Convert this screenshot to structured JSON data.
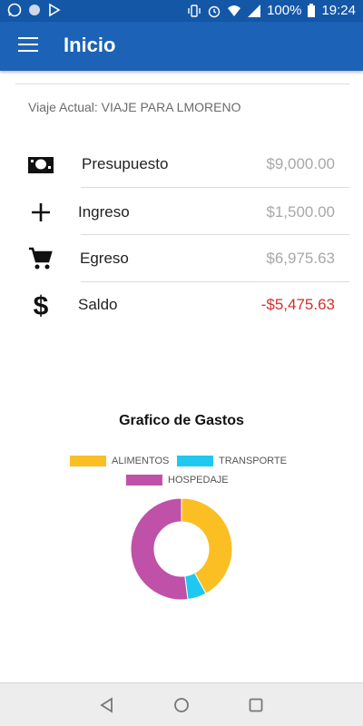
{
  "status": {
    "battery": "100%",
    "time": "19:24"
  },
  "appbar": {
    "title": "Inicio"
  },
  "trip": {
    "text": "Viaje Actual: VIAJE PARA LMORENO"
  },
  "rows": [
    {
      "label": "Presupuesto",
      "value": "$9,000.00",
      "icon": "money-icon"
    },
    {
      "label": "Ingreso",
      "value": "$1,500.00",
      "icon": "plus-icon"
    },
    {
      "label": "Egreso",
      "value": "$6,975.63",
      "icon": "cart-icon"
    },
    {
      "label": "Saldo",
      "value": "-$5,475.63",
      "icon": "dollar-icon"
    }
  ],
  "colors": {
    "primary": "#1c63b7",
    "negative": "#d32f2f",
    "alimentos": "#fbbf24",
    "transporte": "#1ec8f0",
    "hospedaje": "#c051a8"
  },
  "chart": {
    "title": "Grafico de Gastos",
    "legend": [
      "ALIMENTOS",
      "TRANSPORTE",
      "HOSPEDAJE"
    ]
  },
  "chart_data": {
    "type": "pie",
    "title": "Grafico de Gastos",
    "categories": [
      "ALIMENTOS",
      "TRANSPORTE",
      "HOSPEDAJE"
    ],
    "values": [
      42,
      6,
      52
    ],
    "legend_position": "top"
  }
}
